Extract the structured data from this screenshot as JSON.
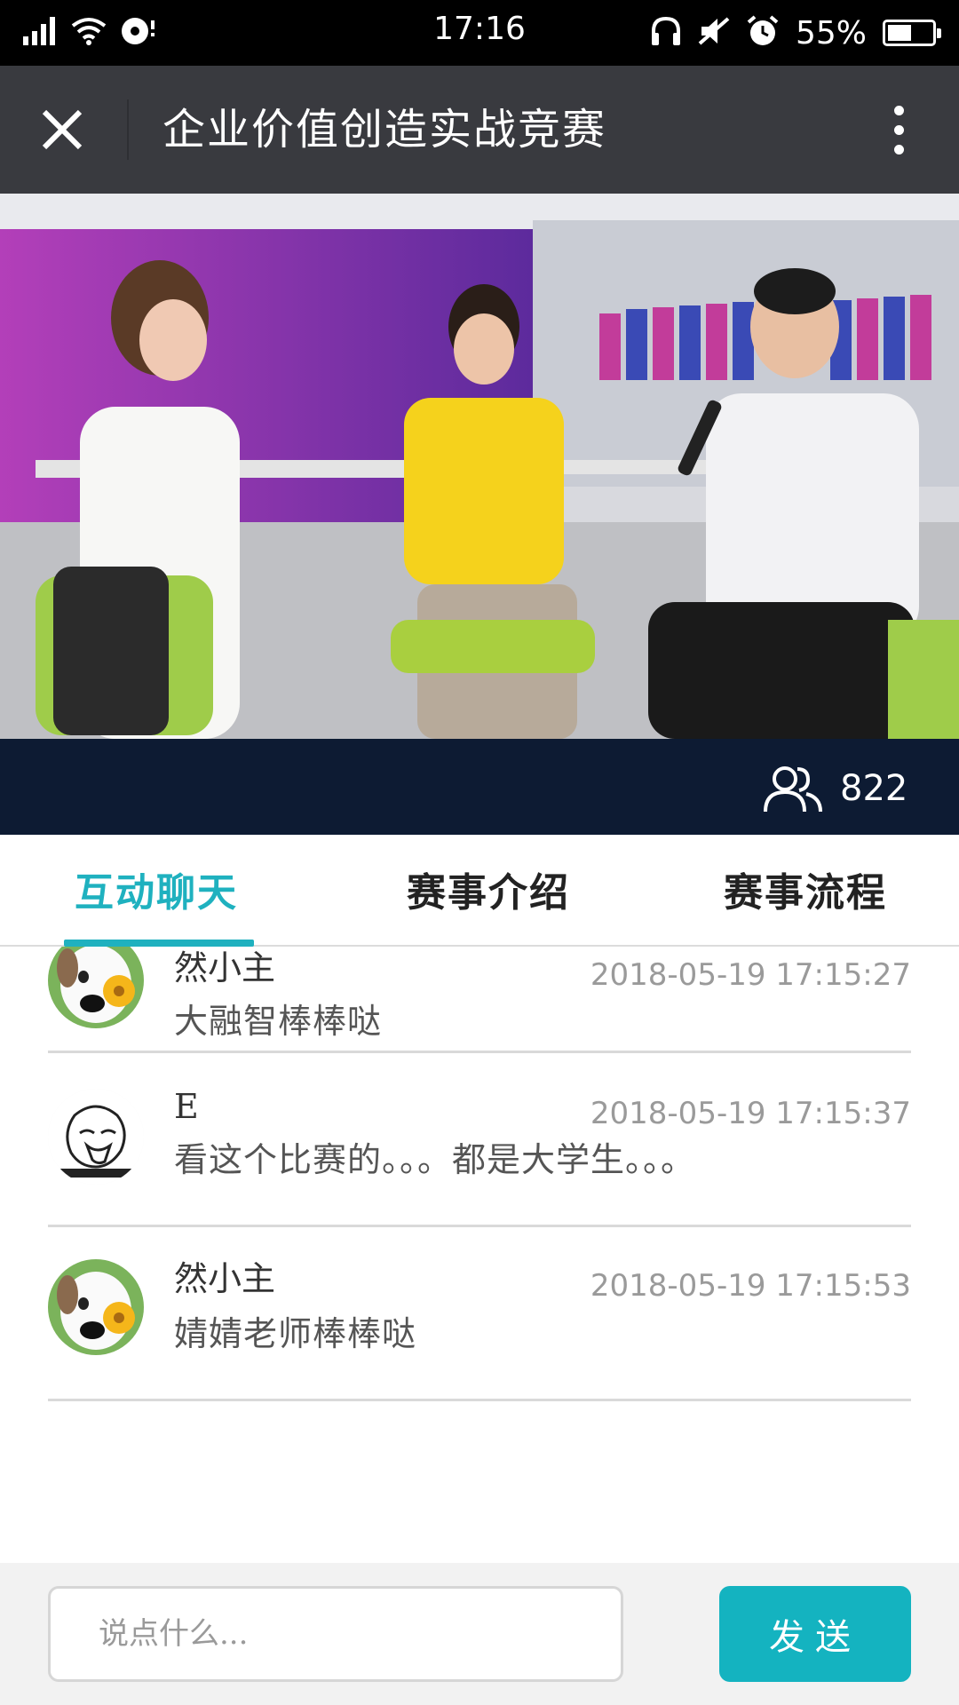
{
  "status_bar": {
    "time": "17:16",
    "battery": "55%",
    "battery_level": 0.55,
    "icons": [
      "signal-icon",
      "wifi-icon",
      "sync-icon",
      "headphones-icon",
      "mute-icon",
      "alarm-icon",
      "battery-icon"
    ]
  },
  "title_bar": {
    "title": "企业价值创造实战竞赛",
    "close_icon": "close-icon",
    "more_icon": "more-icon"
  },
  "viewers": {
    "icon": "users-icon",
    "count": "822"
  },
  "tabs": [
    {
      "label": "互动聊天",
      "active": true
    },
    {
      "label": "赛事介绍",
      "active": false
    },
    {
      "label": "赛事流程",
      "active": false
    }
  ],
  "messages": [
    {
      "name": "然小主",
      "time": "2018-05-19 17:15:27",
      "text": "大融智棒棒哒",
      "avatar": "dog-avatar"
    },
    {
      "name": "E",
      "time": "2018-05-19 17:15:37",
      "text": "看这个比赛的。。。都是大学生。。。",
      "avatar": "sketch-avatar"
    },
    {
      "name": "然小主",
      "time": "2018-05-19 17:15:53",
      "text": "婧婧老师棒棒哒",
      "avatar": "dog-avatar"
    }
  ],
  "input": {
    "placeholder": "说点什么...",
    "value": ""
  },
  "send_button": "发送",
  "colors": {
    "accent": "#1fb1bf",
    "title_bar": "#393a3f",
    "viewer_bar": "#0d1b33"
  }
}
